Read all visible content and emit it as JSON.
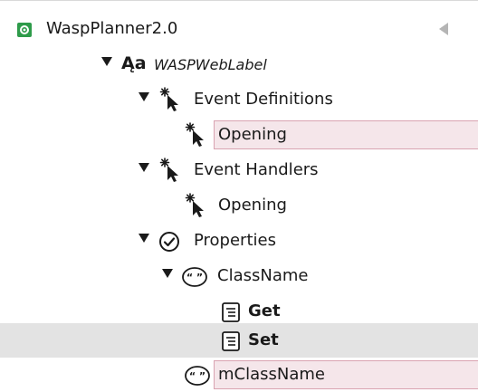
{
  "tree": {
    "root": {
      "label": "WaspPlanner2.0",
      "icon": "module-icon",
      "accent": "#2e9b4a"
    },
    "collapse_icon": "collapse-left-icon",
    "items": [
      {
        "label": "WASPWebLabel",
        "icon": "web-label-icon",
        "expanded": true
      },
      {
        "label": "Event Definitions",
        "icon": "event-cursor-icon",
        "expanded": true
      },
      {
        "label": "Opening",
        "icon": "event-cursor-icon",
        "editing": true
      },
      {
        "label": "Event Handlers",
        "icon": "event-cursor-icon",
        "expanded": true
      },
      {
        "label": "Opening",
        "icon": "event-cursor-icon"
      },
      {
        "label": "Properties",
        "icon": "checkmark-circle-icon",
        "expanded": true
      },
      {
        "label": "ClassName",
        "icon": "quote-icon",
        "expanded": true
      },
      {
        "label": "Get",
        "icon": "document-icon"
      },
      {
        "label": "Set",
        "icon": "document-icon",
        "selected": true
      },
      {
        "label": "mClassName",
        "icon": "quote-icon",
        "editing": true
      }
    ]
  },
  "colors": {
    "selected_row": "#e3e3e3",
    "edit_field": "#f5e6ea",
    "edit_border": "#d9a3b1"
  }
}
